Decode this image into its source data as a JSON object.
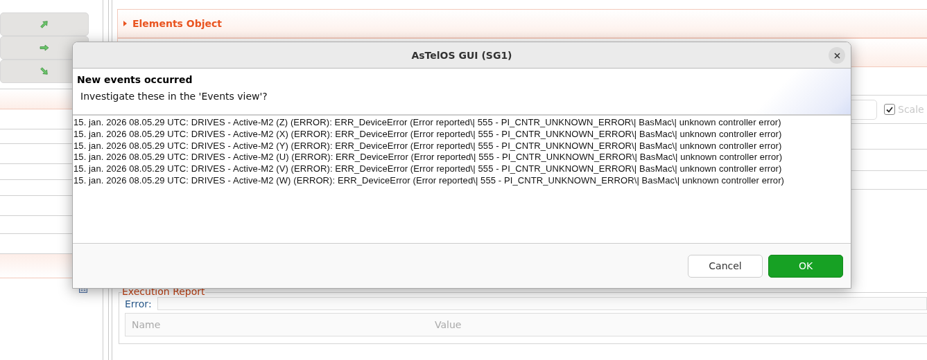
{
  "background": {
    "nav_buttons": [
      {
        "kind": "up"
      },
      {
        "kind": "right"
      },
      {
        "kind": "down"
      }
    ],
    "section_title": "Elements Object",
    "scale_checkbox": {
      "label": "Scale",
      "checked": true
    },
    "execution_report": {
      "title": "Execution Report",
      "error_label": "Error:",
      "columns": [
        "Name",
        "Value"
      ]
    }
  },
  "dialog": {
    "title": "AsTelOS GUI (SG1)",
    "heading": "New events occurred",
    "question": "Investigate these in the 'Events view'?",
    "events": [
      "15. jan. 2026 08.05.29 UTC: DRIVES - Active-M2 (Z) (ERROR): ERR_DeviceError (Error reported\\| 555 - PI_CNTR_UNKNOWN_ERROR\\| BasMac\\| unknown controller error)",
      "15. jan. 2026 08.05.29 UTC: DRIVES - Active-M2 (X) (ERROR): ERR_DeviceError (Error reported\\| 555 - PI_CNTR_UNKNOWN_ERROR\\| BasMac\\| unknown controller error)",
      "15. jan. 2026 08.05.29 UTC: DRIVES - Active-M2 (Y) (ERROR): ERR_DeviceError (Error reported\\| 555 - PI_CNTR_UNKNOWN_ERROR\\| BasMac\\| unknown controller error)",
      "15. jan. 2026 08.05.29 UTC: DRIVES - Active-M2 (U) (ERROR): ERR_DeviceError (Error reported\\| 555 - PI_CNTR_UNKNOWN_ERROR\\| BasMac\\| unknown controller error)",
      "15. jan. 2026 08.05.29 UTC: DRIVES - Active-M2 (V) (ERROR): ERR_DeviceError (Error reported\\| 555 - PI_CNTR_UNKNOWN_ERROR\\| BasMac\\| unknown controller error)",
      "15. jan. 2026 08.05.29 UTC: DRIVES - Active-M2 (W) (ERROR): ERR_DeviceError (Error reported\\| 555 - PI_CNTR_UNKNOWN_ERROR\\| BasMac\\| unknown controller error)"
    ],
    "buttons": [
      {
        "label": "Cancel",
        "kind": "secondary"
      },
      {
        "label": "OK",
        "kind": "primary"
      }
    ]
  }
}
